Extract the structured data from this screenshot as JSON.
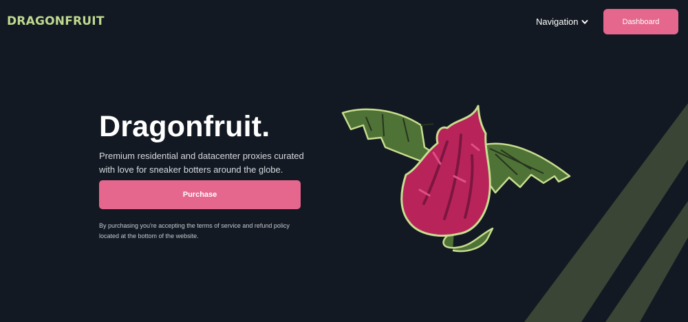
{
  "header": {
    "logo_text": "DRAGONFRUIT",
    "nav_label": "Navigation",
    "dashboard_label": "Dashboard"
  },
  "hero": {
    "title": "Dragonfruit.",
    "subtitle": "Premium residential and datacenter proxies curated with love for sneaker botters around the globe.",
    "purchase_label": "Purchase",
    "disclaimer": "By purchasing you're accepting the terms of service and refund policy located at the bottom of the website."
  },
  "icons": {
    "nav_dropdown": "chevron-down-icon",
    "mascot": "dragonfruit-mascot-icon"
  },
  "colors": {
    "background": "#131922",
    "accent": "#e5678e",
    "logo": "#bfd98f",
    "wing_green": "#4f7236",
    "fruit_pink": "#b8245a",
    "decor_stripe": "#3a4536"
  }
}
